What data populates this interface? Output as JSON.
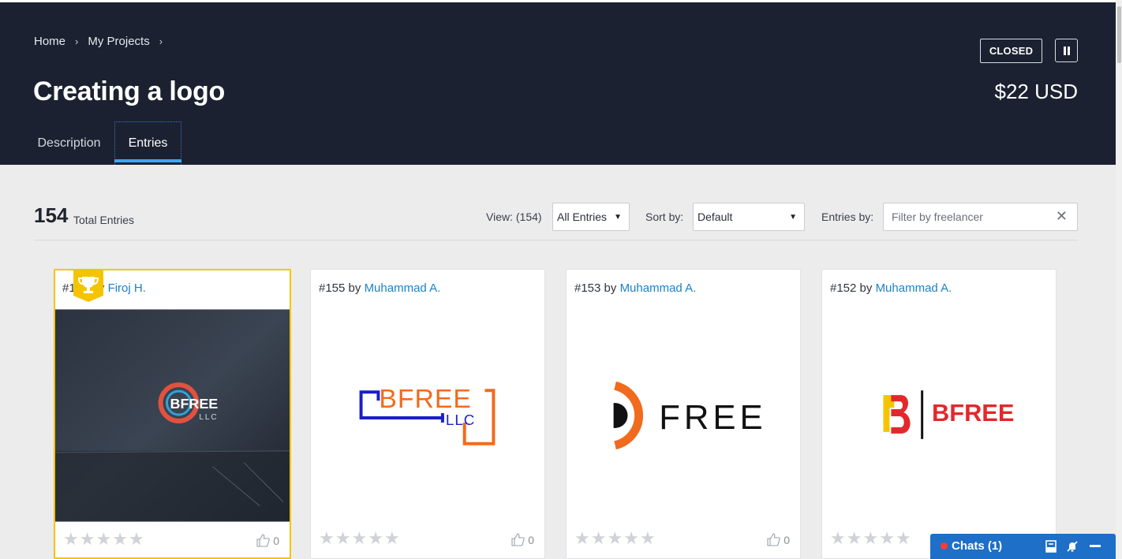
{
  "header": {
    "breadcrumb": [
      "Home",
      "My Projects"
    ],
    "breadcrumb_separator": "›",
    "title": "Creating a logo",
    "status": "CLOSED",
    "price": "$22 USD",
    "tabs": [
      {
        "label": "Description",
        "active": false
      },
      {
        "label": "Entries",
        "active": true
      }
    ],
    "colors": {
      "background": "#1b2130",
      "tab_accent": "#3ea5f4"
    }
  },
  "toolbar": {
    "total_count": "154",
    "total_label": "Total Entries",
    "view_label": "View: (154)",
    "view_selected": "All Entries",
    "sort_label": "Sort by:",
    "sort_selected": "Default",
    "entries_by_label": "Entries by:",
    "filter_placeholder": "Filter by freelancer"
  },
  "entries": [
    {
      "number": "#154",
      "by": "by",
      "author": "Firoj H.",
      "winner": true,
      "likes": "0",
      "rating": 0,
      "logo_text": "BFREE",
      "logo_sub": "LLC"
    },
    {
      "number": "#155",
      "by": "by",
      "author": "Muhammad A.",
      "winner": false,
      "likes": "0",
      "rating": 0,
      "logo_text": "BFREE",
      "logo_sub": "LLC"
    },
    {
      "number": "#153",
      "by": "by",
      "author": "Muhammad A.",
      "winner": false,
      "likes": "0",
      "rating": 0,
      "logo_text": "FREE"
    },
    {
      "number": "#152",
      "by": "by",
      "author": "Muhammad A.",
      "winner": false,
      "likes": "0",
      "rating": 0,
      "logo_text": "BFREE"
    }
  ],
  "chats": {
    "label": "Chats (1)"
  },
  "icons": {
    "pause": "pause-icon",
    "winner": "trophy-icon",
    "like": "thumbs-up-icon",
    "star": "star-icon",
    "clear": "close-icon",
    "chat_inbox": "inbox-icon",
    "chat_mute": "bell-off-icon",
    "chat_minimize": "minimize-icon"
  }
}
